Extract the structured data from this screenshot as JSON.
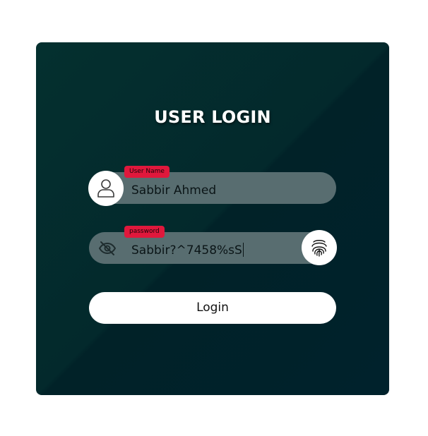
{
  "login_form": {
    "title": "USER LOGIN",
    "username": {
      "label": "User Name",
      "value": "Sabbir Ahmed",
      "icon": "user-icon"
    },
    "password": {
      "label": "password",
      "value": "Sabbir?^7458%sS",
      "toggle_icon": "eye-slash-icon",
      "biometric_icon": "fingerprint-icon"
    },
    "submit_label": "Login"
  },
  "colors": {
    "card_background": "#012a2e",
    "field_background": "#586d70",
    "badge_background": "#e0183c",
    "button_background": "#ffffff"
  }
}
